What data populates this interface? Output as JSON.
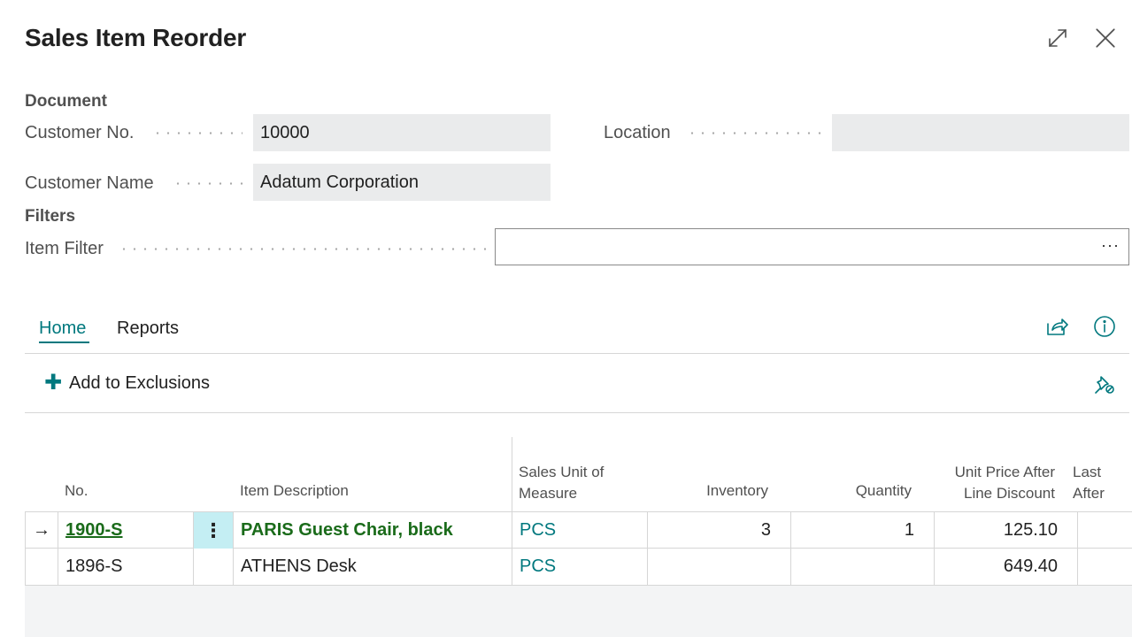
{
  "title": "Sales Item Reorder",
  "window": {
    "expand_icon": "expand-icon",
    "close_icon": "close-icon"
  },
  "document": {
    "heading": "Document",
    "customer_no_label": "Customer No.",
    "customer_no_value": "10000",
    "location_label": "Location",
    "location_value": "",
    "customer_name_label": "Customer Name",
    "customer_name_value": "Adatum Corporation"
  },
  "filters": {
    "heading": "Filters",
    "item_filter_label": "Item Filter",
    "item_filter_value": "",
    "assist_label": "···"
  },
  "tabs": [
    {
      "label": "Home",
      "active": true
    },
    {
      "label": "Reports",
      "active": false
    }
  ],
  "actions": {
    "add_to_exclusions": "Add to Exclusions"
  },
  "icons": {
    "share": "share-icon",
    "info": "info-icon",
    "pin": "pin-icon"
  },
  "accent_color": "#00787e",
  "table": {
    "headers": {
      "no": "No.",
      "description": "Item Description",
      "uom_line1": "Sales Unit of",
      "uom_line2": "Measure",
      "inventory": "Inventory",
      "quantity": "Quantity",
      "unit_price_line1": "Unit Price After",
      "unit_price_line2": "Line Discount",
      "last_line1": "Last",
      "last_line2": "After"
    },
    "rows": [
      {
        "no": "1900-S",
        "description": "PARIS Guest Chair, black",
        "uom": "PCS",
        "inventory": "3",
        "quantity": "1",
        "unit_price": "125.10",
        "selected": true
      },
      {
        "no": "1896-S",
        "description": "ATHENS Desk",
        "uom": "PCS",
        "inventory": "",
        "quantity": "",
        "unit_price": "649.40",
        "selected": false
      }
    ],
    "row_menu_glyph": "⋮",
    "row_pointer_glyph": "→"
  }
}
